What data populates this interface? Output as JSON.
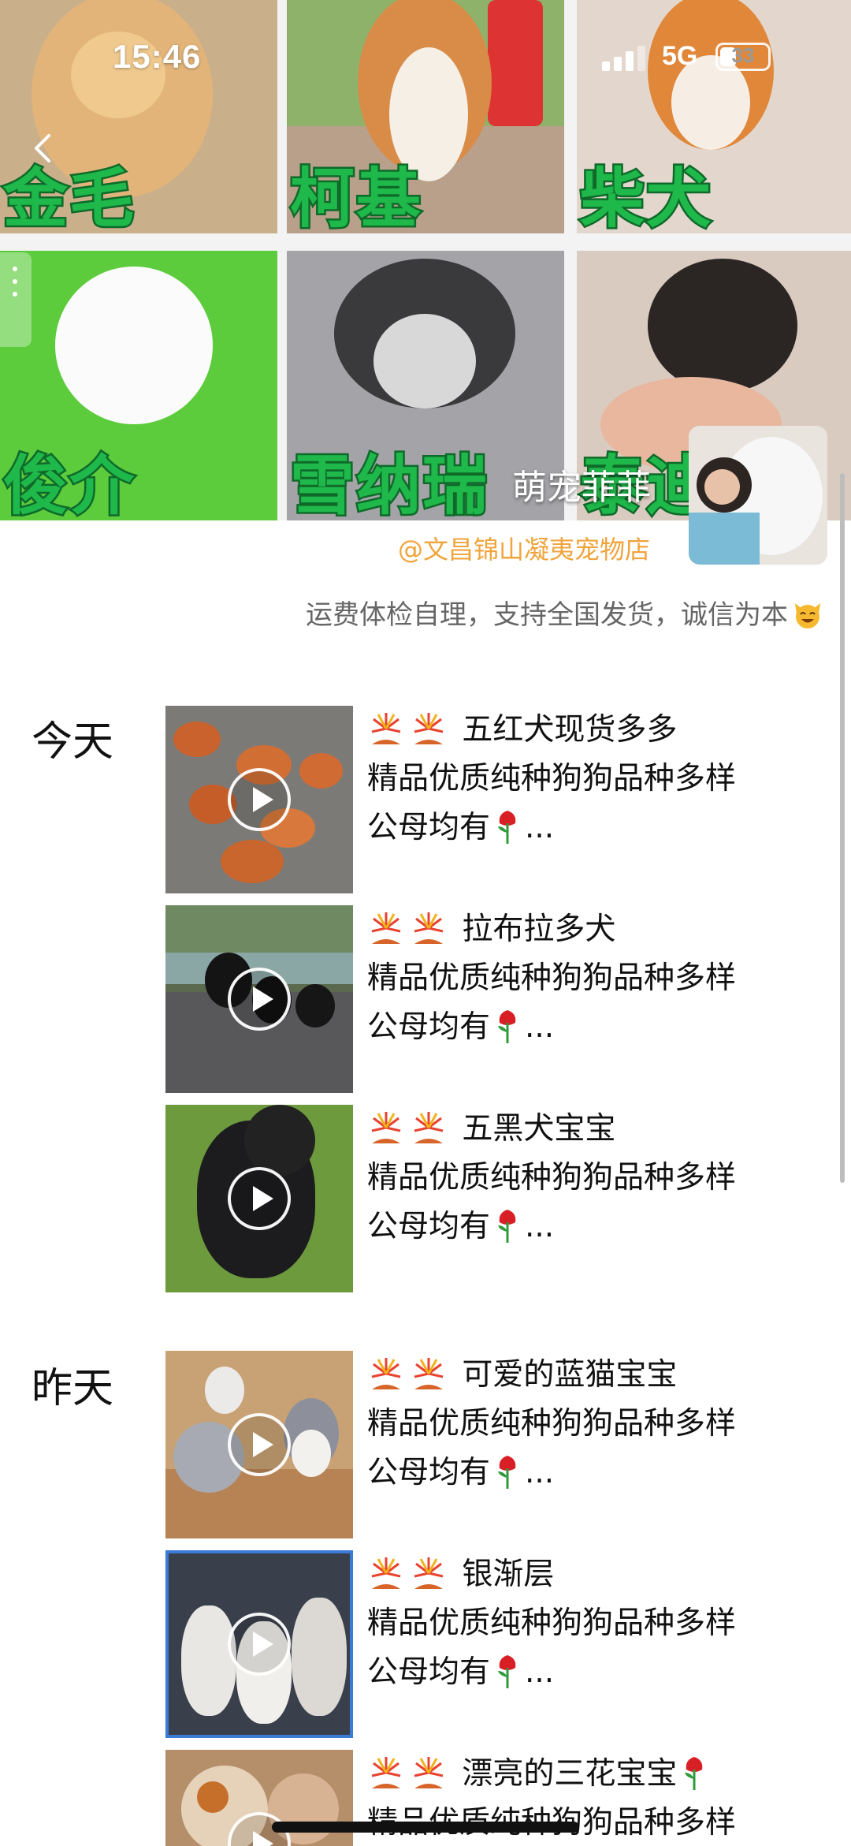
{
  "status_bar": {
    "time": "15:46",
    "network": "5G",
    "battery": "33"
  },
  "cover": {
    "tiles": [
      "金毛",
      "柯基",
      "柴犬",
      "俊介",
      "雪纳瑞",
      "泰迪"
    ],
    "owner_name": "萌宠菲菲"
  },
  "profile": {
    "shop_link": "@文昌锦山凝夷宠物店",
    "signature": "运费体检自理，支持全国发货，诚信为本"
  },
  "timeline": [
    {
      "day": "今天",
      "posts": [
        {
          "title": "五红犬现货多多",
          "line2": "精品优质纯种狗狗品种多样",
          "line3": "公母均有",
          "ellipsis": "..."
        },
        {
          "title": "拉布拉多犬",
          "line2": "精品优质纯种狗狗品种多样",
          "line3": "公母均有",
          "ellipsis": "..."
        },
        {
          "title": "五黑犬宝宝",
          "line2": "精品优质纯种狗狗品种多样",
          "line3": "公母均有",
          "ellipsis": "..."
        }
      ]
    },
    {
      "day": "昨天",
      "posts": [
        {
          "title": "可爱的蓝猫宝宝",
          "line2": "精品优质纯种狗狗品种多样",
          "line3": "公母均有",
          "ellipsis": "..."
        },
        {
          "title": "银渐层",
          "line2": "精品优质纯种狗狗品种多样",
          "line3": "公母均有",
          "ellipsis": "..."
        },
        {
          "title": "漂亮的三花宝宝",
          "line2": "精品优质纯种狗狗品种多样",
          "line3": "",
          "ellipsis": ""
        }
      ]
    }
  ],
  "colors": {
    "label_green": "#1fb84a",
    "shop_link": "#f0a43c"
  },
  "icons": [
    "back-arrow-icon",
    "play-icon",
    "fireworks-icon",
    "rose-icon",
    "cat-face-icon"
  ]
}
